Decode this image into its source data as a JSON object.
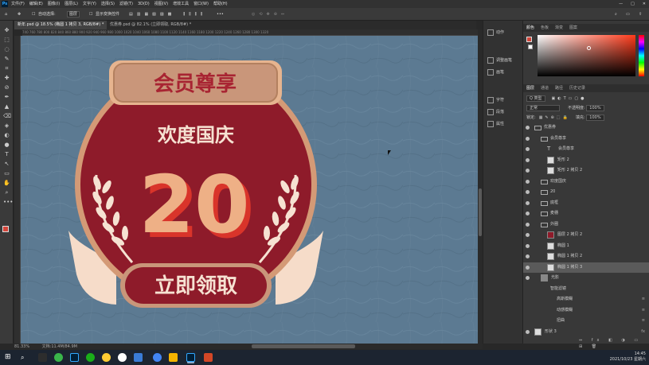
{
  "menubar": {
    "logo": "Ps",
    "menus": [
      "文件(F)",
      "编辑(E)",
      "图像(I)",
      "图层(L)",
      "文字(Y)",
      "选择(S)",
      "滤镜(T)",
      "3D(D)",
      "视图(V)",
      "增效工具",
      "窗口(W)",
      "帮助(H)"
    ],
    "window_controls": [
      "—",
      "□",
      "✕"
    ]
  },
  "options": {
    "auto_select_label": "自动选择:",
    "auto_select_value": "图层",
    "show_transform_label": "显示变换控件",
    "more": "•••"
  },
  "tabs": [
    {
      "label": "新年.psd @ 18.5% (椭圆 1 拷贝 3, RGB/8#) *",
      "active": true
    },
    {
      "label": "优惠券.psd @ 82.1% (立即领取, RGB/8#) *",
      "active": false
    }
  ],
  "ruler": "740  760  780  800  820  840  860  880  900  920  940  960  980  1000  1020  1040  1060  1080  1100  1120  1140  1160  1180  1200  1220  1240  1260  1280  1300  1320",
  "status": {
    "zoom": "81.33%",
    "doc": "文档:11.4M/84.9M"
  },
  "badge": {
    "header": "会员尊享",
    "subtitle": "欢度国庆",
    "number": "20",
    "button": "立即领取"
  },
  "mid_panel": [
    {
      "icon": "play-icon",
      "label": "动作"
    },
    {
      "icon": "adjust-icon",
      "label": "调整画笔"
    },
    {
      "icon": "brush-icon",
      "label": "画笔"
    },
    {
      "icon": "char-icon",
      "label": "字符"
    },
    {
      "icon": "para-icon",
      "label": "段落"
    },
    {
      "icon": "prop-icon",
      "label": "属性"
    }
  ],
  "color_panel": {
    "tabs": [
      "颜色",
      "色板",
      "渐变",
      "图案"
    ],
    "fg_color": "#d4453a",
    "bg_color": "#ffffff"
  },
  "layers_panel": {
    "tabs": [
      "图层",
      "通道",
      "路径",
      "历史记录"
    ],
    "kind_label": "Q 类型",
    "blend_mode": "正常",
    "opacity_label": "不透明度:",
    "opacity_value": "100%",
    "lock_label": "锁定:",
    "fill_label": "填充:",
    "fill_value": "100%",
    "layers": [
      {
        "name": "优惠券",
        "indent": 0,
        "type": "group",
        "selected": false,
        "fx": ""
      },
      {
        "name": "会员尊享",
        "indent": 1,
        "type": "group",
        "selected": false,
        "fx": ""
      },
      {
        "name": "会员尊享",
        "indent": 2,
        "type": "text",
        "selected": false,
        "fx": ""
      },
      {
        "name": "矩形 2",
        "indent": 2,
        "type": "shape",
        "selected": false,
        "fx": ""
      },
      {
        "name": "矩形 2 拷贝 2",
        "indent": 2,
        "type": "shape",
        "selected": false,
        "fx": ""
      },
      {
        "name": "欢度国庆",
        "indent": 1,
        "type": "group",
        "selected": false,
        "fx": ""
      },
      {
        "name": "20",
        "indent": 1,
        "type": "group",
        "selected": false,
        "fx": ""
      },
      {
        "name": "底框",
        "indent": 1,
        "type": "group",
        "selected": false,
        "fx": ""
      },
      {
        "name": "麦穗",
        "indent": 1,
        "type": "group",
        "selected": false,
        "fx": ""
      },
      {
        "name": "外圈",
        "indent": 1,
        "type": "group",
        "selected": false,
        "fx": ""
      },
      {
        "name": "图层 2 拷贝 2",
        "indent": 2,
        "type": "fill",
        "selected": false,
        "fx": ""
      },
      {
        "name": "椭圆 1",
        "indent": 2,
        "type": "shape",
        "selected": false,
        "fx": ""
      },
      {
        "name": "椭圆 1 拷贝 2",
        "indent": 2,
        "type": "shape",
        "selected": false,
        "fx": ""
      },
      {
        "name": "椭圆 1 拷贝 3",
        "indent": 2,
        "type": "shape",
        "selected": true,
        "fx": ""
      },
      {
        "name": "光影",
        "indent": 1,
        "type": "smart",
        "selected": false,
        "fx": ""
      },
      {
        "name": "智能滤镜",
        "indent": 2,
        "type": "filter",
        "selected": false,
        "fx": ""
      },
      {
        "name": "高斯模糊",
        "indent": 3,
        "type": "filter",
        "selected": false,
        "fx": "≡"
      },
      {
        "name": "动感模糊",
        "indent": 3,
        "type": "filter",
        "selected": false,
        "fx": "≡"
      },
      {
        "name": "扭曲",
        "indent": 3,
        "type": "filter",
        "selected": false,
        "fx": "≡"
      },
      {
        "name": "形状 3",
        "indent": 0,
        "type": "shape",
        "selected": false,
        "fx": "fx"
      }
    ]
  },
  "taskbar": {
    "time": "14:45",
    "date": "2021/10/23 星期六"
  }
}
